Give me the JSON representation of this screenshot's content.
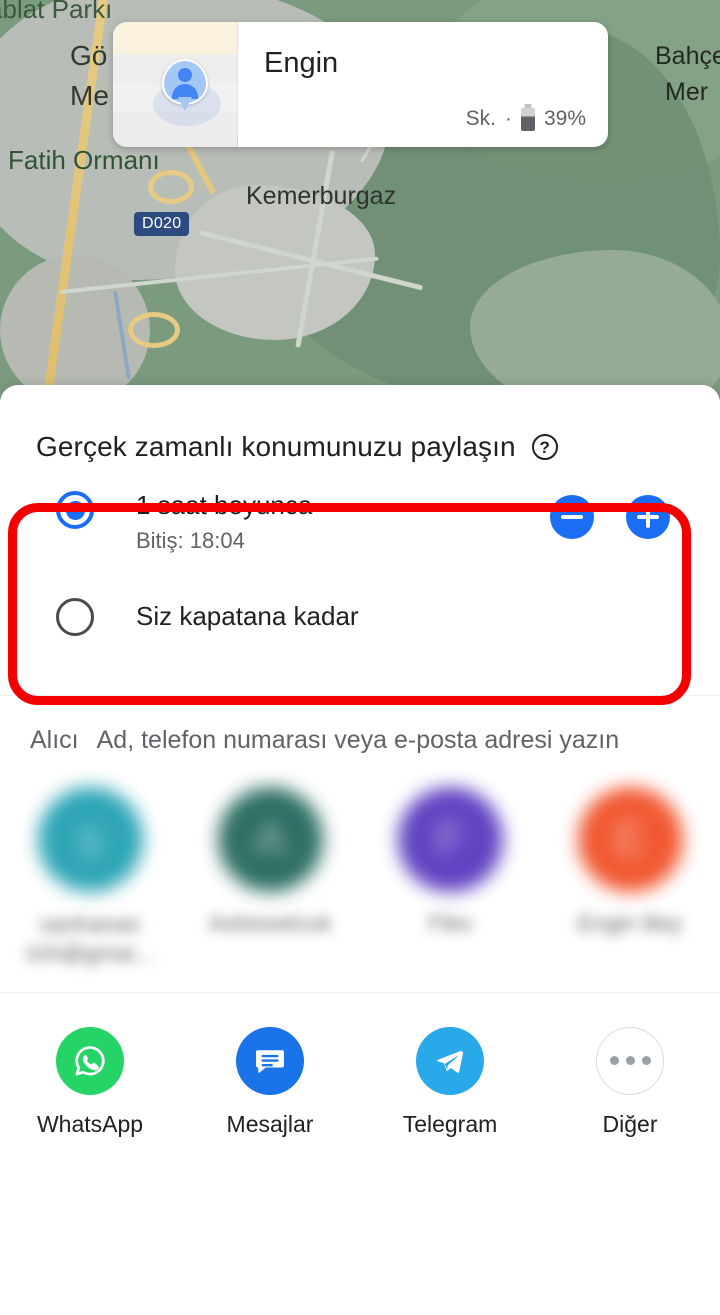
{
  "map": {
    "labels": [
      {
        "text": "ablat Parkı"
      },
      {
        "text": "Gö"
      },
      {
        "text": "Me"
      },
      {
        "text": "Fatih Ormanı"
      },
      {
        "text": "Kemerburgaz"
      },
      {
        "text": "Bahçe"
      },
      {
        "text": "Mer"
      }
    ],
    "road_shield": "D020"
  },
  "person_card": {
    "name": "Engin",
    "status": "Sk.",
    "separator": "·",
    "battery_percent": "39%"
  },
  "sheet": {
    "title": "Gerçek zamanlı konumunuzu paylaşın",
    "help_glyph": "?",
    "duration_options": [
      {
        "label": "1 saat boyunca",
        "sublabel": "Bitiş: 18:04",
        "selected": true
      },
      {
        "label": "Siz kapatana kadar",
        "sublabel": "",
        "selected": false
      }
    ],
    "stepper": {
      "decrease_label": "−",
      "increase_label": "+"
    },
    "recipient": {
      "label": "Alıcı",
      "placeholder": "Ad, telefon numarası veya e-posta adresi yazın"
    },
    "contacts": [
      {
        "initial": "s",
        "name_line1": "sanhanan",
        "name_line2": "ichi@gmai...",
        "color": "#1c9eb0"
      },
      {
        "initial": "A",
        "name_line1": "Aslıtoselcuk",
        "name_line2": "",
        "color": "#1d6358"
      },
      {
        "initial": "F",
        "name_line1": "Fiko",
        "name_line2": "",
        "color": "#5433bd"
      },
      {
        "initial": "E",
        "name_line1": "Engin Bey",
        "name_line2": "",
        "color": "#f04a20"
      }
    ],
    "share_apps": [
      {
        "label": "WhatsApp",
        "icon": "whatsapp-icon",
        "color": "#25d366"
      },
      {
        "label": "Mesajlar",
        "icon": "messages-icon",
        "color": "#1a73e8"
      },
      {
        "label": "Telegram",
        "icon": "telegram-icon",
        "color": "#29a9e9"
      },
      {
        "label": "Diğer",
        "icon": "more-horizontal-icon",
        "color": "#9aa0a6"
      }
    ]
  },
  "annotation": {
    "highlight_color": "#f50000"
  }
}
